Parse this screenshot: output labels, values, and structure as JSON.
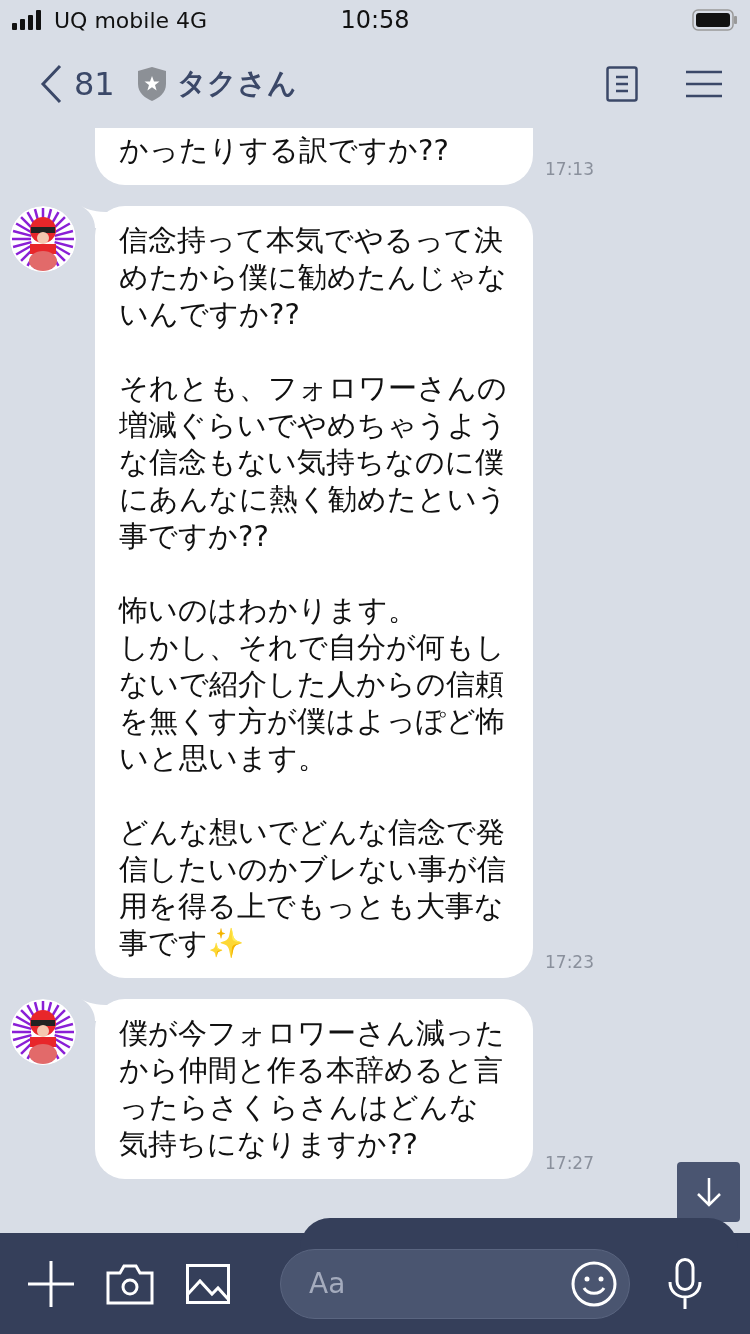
{
  "status_bar": {
    "carrier": "UQ mobile 4G",
    "time": "10:58"
  },
  "header": {
    "back_count": "81",
    "title": "タクさん"
  },
  "messages": [
    {
      "kind": "continued",
      "time": "17:13",
      "paragraphs": [
        [
          "かったりする訳ですか??"
        ]
      ]
    },
    {
      "kind": "with_avatar",
      "time": "17:23",
      "paragraphs": [
        [
          "信念持って本気でやるって決めたから僕に勧めたんじゃないんですか??"
        ],
        [
          "それとも、フォロワーさんの増減ぐらいでやめちゃうような信念もない気持ちなのに僕にあんなに熱く勧めたという事ですか??"
        ],
        [
          "怖いのはわかります。",
          "しかし、それで自分が何もしないで紹介した人からの信頼を無くす方が僕はよっぽど怖いと思います。"
        ],
        [
          "どんな想いでどんな信念で発信したいのかブレない事が信用を得る上でもっとも大事な事です✨"
        ]
      ]
    },
    {
      "kind": "with_avatar",
      "time": "17:27",
      "paragraphs": [
        [
          "僕が今フォロワーさん減ったから仲間と作る本辞めると言ったらさくらさんはどんな気持ちになりますか??"
        ]
      ]
    }
  ],
  "input": {
    "placeholder": "Aa"
  }
}
